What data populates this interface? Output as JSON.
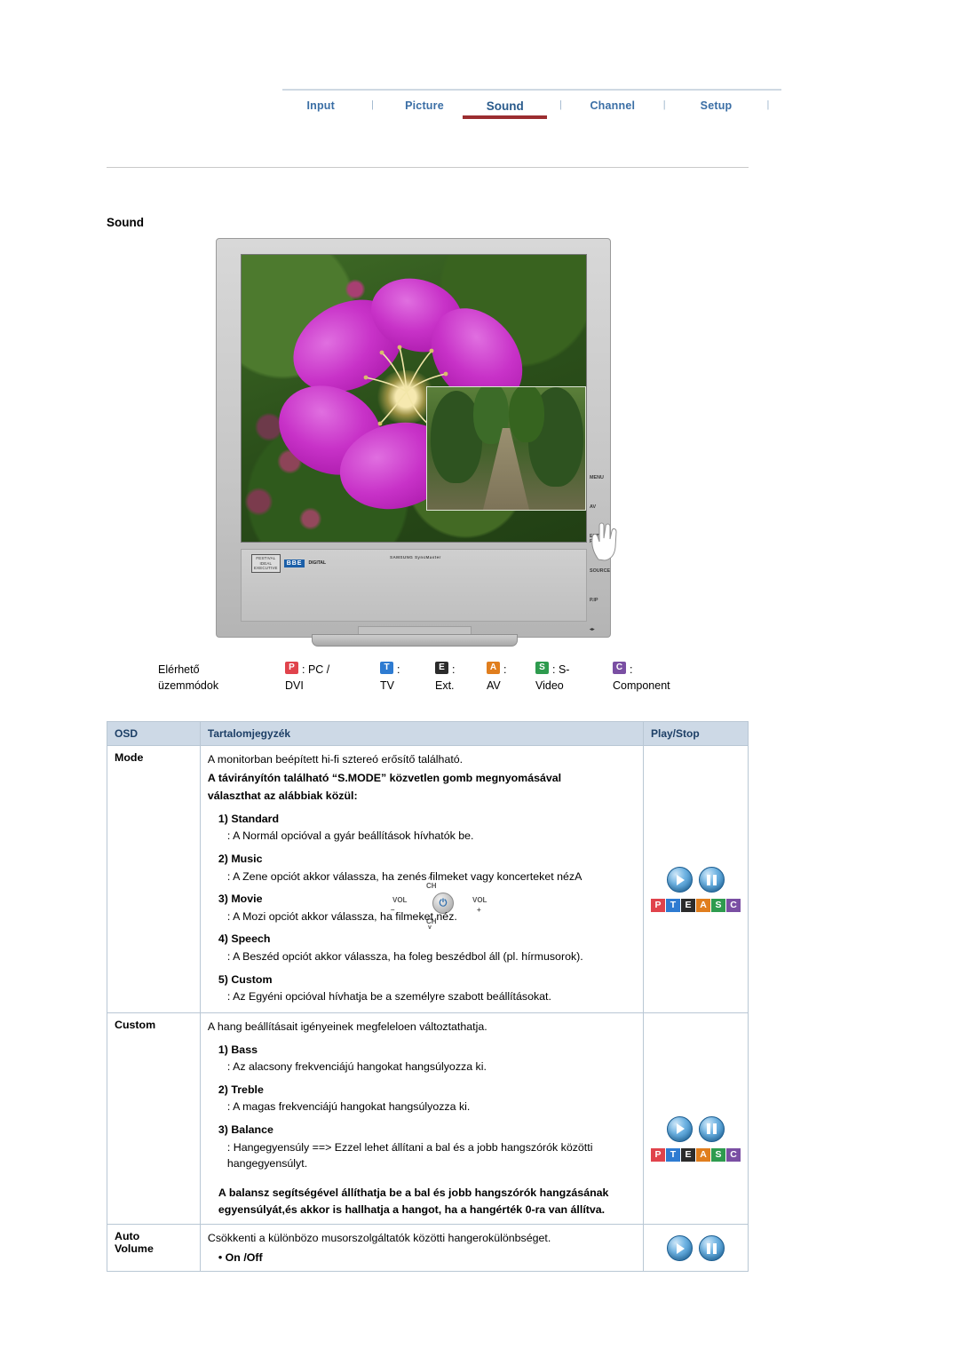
{
  "nav": {
    "items": [
      {
        "label": "Input",
        "active": false
      },
      {
        "label": "Picture",
        "active": false
      },
      {
        "label": "Sound",
        "active": true
      },
      {
        "label": "Channel",
        "active": false
      },
      {
        "label": "Setup",
        "active": false
      }
    ],
    "separator": "|"
  },
  "page": {
    "title": "Sound"
  },
  "device": {
    "bbe_box_lines": "FESTIVAL\nIDEAL\nEXECUTIVE",
    "bbe_logo": "BBE",
    "bbe_digital": "DIGITAL",
    "brand_text": "SAMSUNG SyncMaster",
    "controls": {
      "ch_up": "CH",
      "ch_down": "CH",
      "vol_left": "VOL",
      "vol_right": "VOL",
      "power": "⏻",
      "minus": "–",
      "plus": "+"
    },
    "side_labels": [
      "MENU",
      "AV",
      "ENTER/\nFM RADIO",
      "SOURCE",
      "P.IP",
      "VOL"
    ]
  },
  "legend": {
    "label_line1": "Elérhető",
    "label_line2": "üzemmódok",
    "items": [
      {
        "key": "P",
        "color": "#e0434c",
        "text_line1": ": PC /",
        "text_line2": "DVI"
      },
      {
        "key": "T",
        "color": "#2e7bd1",
        "text_line1": ":",
        "text_line2": "TV"
      },
      {
        "key": "E",
        "color": "#2b2b2b",
        "text_line1": ":",
        "text_line2": "Ext."
      },
      {
        "key": "A",
        "color": "#e07e1e",
        "text_line1": ":",
        "text_line2": "AV"
      },
      {
        "key": "S",
        "color": "#2e9b4e",
        "text_line1": ": S-",
        "text_line2": "Video"
      },
      {
        "key": "C",
        "color": "#7a4fa3",
        "text_line1": ":",
        "text_line2": "Component"
      }
    ]
  },
  "table": {
    "headers": {
      "osd": "OSD",
      "desc": "Tartalomjegyzék",
      "play": "Play/Stop"
    },
    "rows": [
      {
        "name": "Mode",
        "lines": [
          {
            "style": "plain",
            "text": "A monitorban beépített hi-fi sztereó erősítő található."
          },
          {
            "style": "bold",
            "text": "A távirányítón található “S.MODE” közvetlen gomb megnyomásával"
          },
          {
            "style": "bold",
            "text": "választhat az alábbiak közül:"
          },
          {
            "style": "sub",
            "text": "1) Standard"
          },
          {
            "style": "sub2",
            "text": ": A Normál opcióval a gyár beállítások hívhatók be."
          },
          {
            "style": "sub",
            "text": "2) Music"
          },
          {
            "style": "sub2",
            "text": ": A Zene opciót akkor válassza, ha zenés filmeket vagy koncerteket nézA"
          },
          {
            "style": "sub",
            "text": "3) Movie"
          },
          {
            "style": "sub2",
            "text": ": A Mozi opciót akkor válassza, ha filmeket néz."
          },
          {
            "style": "sub",
            "text": "4) Speech"
          },
          {
            "style": "sub2",
            "text": ": A Beszéd opciót akkor válassza, ha foleg beszédbol áll (pl. hírmusorok)."
          },
          {
            "style": "sub",
            "text": "5) Custom"
          },
          {
            "style": "sub2",
            "text": ": Az Egyéni opcióval hívhatja be a személyre szabott beállításokat."
          }
        ],
        "keys": [
          "P",
          "T",
          "E",
          "A",
          "S",
          "C"
        ]
      },
      {
        "name": "Custom",
        "lines": [
          {
            "style": "plain",
            "text": "A hang beállításait igényeinek megfeleloen változtathatja."
          },
          {
            "style": "sub",
            "text": "1) Bass"
          },
          {
            "style": "sub2",
            "text": ": Az alacsony frekvenciájú hangokat hangsúlyozza ki."
          },
          {
            "style": "sub",
            "text": "2) Treble"
          },
          {
            "style": "sub2",
            "text": ": A magas frekvenciájú hangokat hangsúlyozza ki."
          },
          {
            "style": "sub",
            "text": "3) Balance"
          },
          {
            "style": "sub2",
            "text": ": Hangegyensúly ==> Ezzel lehet állítani a bal és a jobb hangszórók közötti hangegyensúlyt."
          },
          {
            "style": "blockbold",
            "text": "A balansz segítségével állíthatja be a bal és jobb hangszórók hangzásának egyensúlyát,és akkor is hallhatja a hangot, ha a hangérték 0-ra van állítva."
          }
        ],
        "keys": [
          "P",
          "T",
          "E",
          "A",
          "S",
          "C"
        ]
      },
      {
        "name": "Auto\nVolume",
        "name_line1": "Auto",
        "name_line2": "Volume",
        "lines": [
          {
            "style": "plain",
            "text": "Csökkenti a különbözo musorszolgáltatók közötti hangerokülönbséget."
          },
          {
            "style": "bullet",
            "text": "• On /Off"
          }
        ],
        "keys": []
      }
    ]
  }
}
